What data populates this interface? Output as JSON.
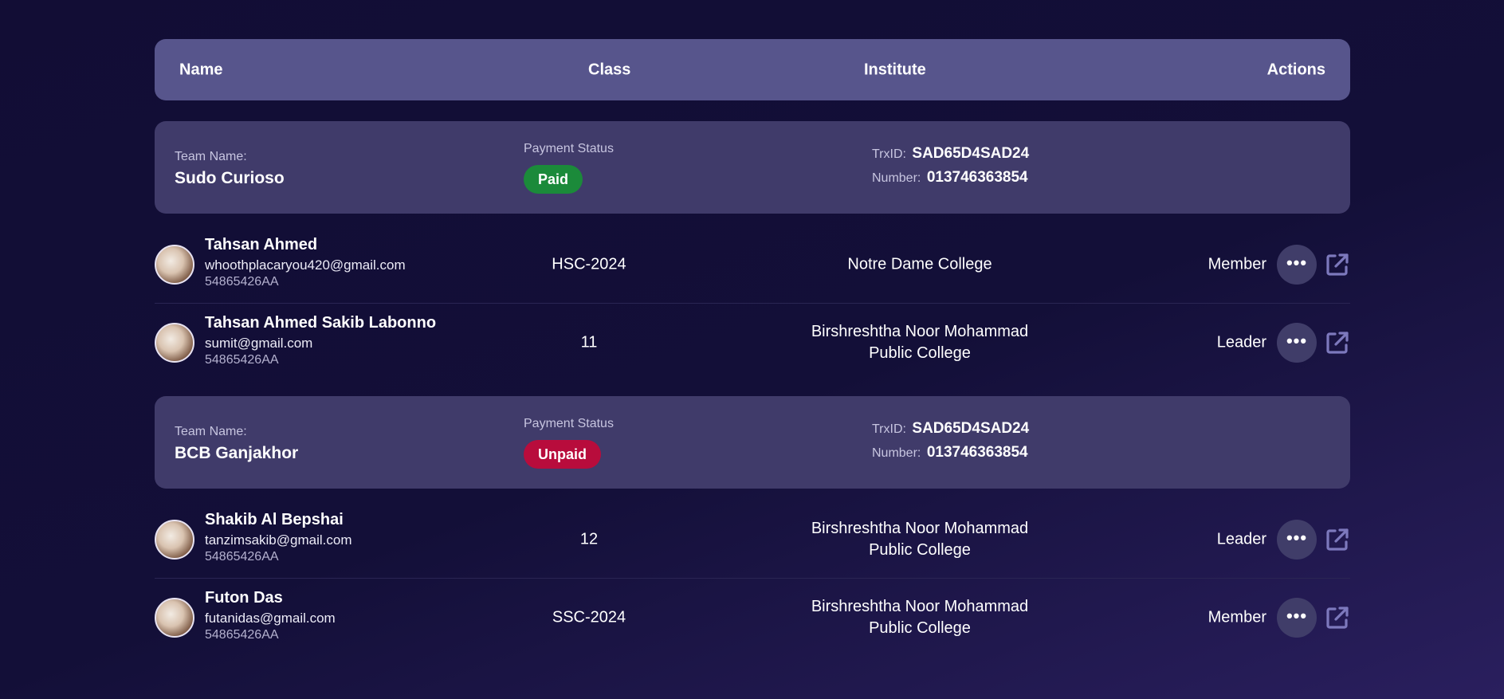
{
  "header": {
    "name": "Name",
    "class": "Class",
    "institute": "Institute",
    "actions": "Actions"
  },
  "teams": [
    {
      "team_label": "Team Name:",
      "team_name": "Sudo Curioso",
      "payment_label": "Payment Status",
      "payment_status": "Paid",
      "trx_label": "TrxID:",
      "trx_id": "SAD65D4SAD24",
      "number_label": "Number:",
      "number": "013746363854",
      "members": [
        {
          "name": "Tahsan Ahmed",
          "email": "whoothplacaryou420@gmail.com",
          "id": "54865426AA",
          "class": "HSC-2024",
          "institute_line1": "Notre Dame College",
          "institute_line2": "",
          "role": "Member"
        },
        {
          "name": "Tahsan Ahmed Sakib Labonno",
          "email": "sumit@gmail.com",
          "id": "54865426AA",
          "class": "11",
          "institute_line1": "Birshreshtha Noor Mohammad",
          "institute_line2": "Public College",
          "role": "Leader"
        }
      ]
    },
    {
      "team_label": "Team Name:",
      "team_name": "BCB Ganjakhor",
      "payment_label": "Payment Status",
      "payment_status": "Unpaid",
      "trx_label": "TrxID:",
      "trx_id": "SAD65D4SAD24",
      "number_label": "Number:",
      "number": "013746363854",
      "members": [
        {
          "name": "Shakib Al Bepshai",
          "email": "tanzimsakib@gmail.com",
          "id": "54865426AA",
          "class": "12",
          "institute_line1": "Birshreshtha Noor Mohammad",
          "institute_line2": "Public College",
          "role": "Leader"
        },
        {
          "name": "Futon Das",
          "email": "futanidas@gmail.com",
          "id": "54865426AA",
          "class": "SSC-2024",
          "institute_line1": "Birshreshtha Noor Mohammad",
          "institute_line2": "Public College",
          "role": "Member"
        }
      ]
    }
  ],
  "icons": {
    "more": "more-horizontal-icon",
    "open": "external-link-icon"
  },
  "colors": {
    "paid": "#1b8a3a",
    "unpaid": "#b80c3c",
    "header_bg": "#57558c",
    "card_bg": "#403b6a"
  }
}
